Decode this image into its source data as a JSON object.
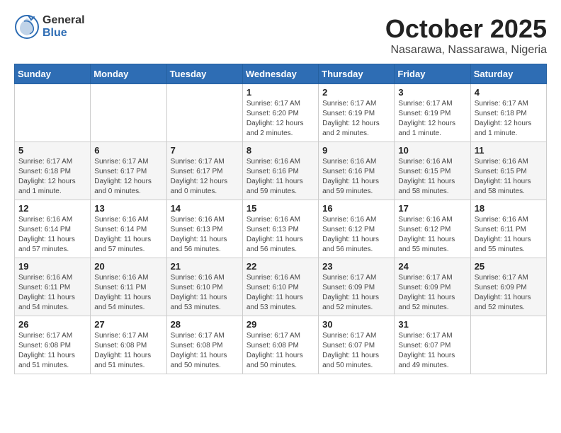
{
  "header": {
    "logo_general": "General",
    "logo_blue": "Blue",
    "month": "October 2025",
    "location": "Nasarawa, Nassarawa, Nigeria"
  },
  "weekdays": [
    "Sunday",
    "Monday",
    "Tuesday",
    "Wednesday",
    "Thursday",
    "Friday",
    "Saturday"
  ],
  "weeks": [
    [
      {
        "day": "",
        "info": ""
      },
      {
        "day": "",
        "info": ""
      },
      {
        "day": "",
        "info": ""
      },
      {
        "day": "1",
        "info": "Sunrise: 6:17 AM\nSunset: 6:20 PM\nDaylight: 12 hours and 2 minutes."
      },
      {
        "day": "2",
        "info": "Sunrise: 6:17 AM\nSunset: 6:19 PM\nDaylight: 12 hours and 2 minutes."
      },
      {
        "day": "3",
        "info": "Sunrise: 6:17 AM\nSunset: 6:19 PM\nDaylight: 12 hours and 1 minute."
      },
      {
        "day": "4",
        "info": "Sunrise: 6:17 AM\nSunset: 6:18 PM\nDaylight: 12 hours and 1 minute."
      }
    ],
    [
      {
        "day": "5",
        "info": "Sunrise: 6:17 AM\nSunset: 6:18 PM\nDaylight: 12 hours and 1 minute."
      },
      {
        "day": "6",
        "info": "Sunrise: 6:17 AM\nSunset: 6:17 PM\nDaylight: 12 hours and 0 minutes."
      },
      {
        "day": "7",
        "info": "Sunrise: 6:17 AM\nSunset: 6:17 PM\nDaylight: 12 hours and 0 minutes."
      },
      {
        "day": "8",
        "info": "Sunrise: 6:16 AM\nSunset: 6:16 PM\nDaylight: 11 hours and 59 minutes."
      },
      {
        "day": "9",
        "info": "Sunrise: 6:16 AM\nSunset: 6:16 PM\nDaylight: 11 hours and 59 minutes."
      },
      {
        "day": "10",
        "info": "Sunrise: 6:16 AM\nSunset: 6:15 PM\nDaylight: 11 hours and 58 minutes."
      },
      {
        "day": "11",
        "info": "Sunrise: 6:16 AM\nSunset: 6:15 PM\nDaylight: 11 hours and 58 minutes."
      }
    ],
    [
      {
        "day": "12",
        "info": "Sunrise: 6:16 AM\nSunset: 6:14 PM\nDaylight: 11 hours and 57 minutes."
      },
      {
        "day": "13",
        "info": "Sunrise: 6:16 AM\nSunset: 6:14 PM\nDaylight: 11 hours and 57 minutes."
      },
      {
        "day": "14",
        "info": "Sunrise: 6:16 AM\nSunset: 6:13 PM\nDaylight: 11 hours and 56 minutes."
      },
      {
        "day": "15",
        "info": "Sunrise: 6:16 AM\nSunset: 6:13 PM\nDaylight: 11 hours and 56 minutes."
      },
      {
        "day": "16",
        "info": "Sunrise: 6:16 AM\nSunset: 6:12 PM\nDaylight: 11 hours and 56 minutes."
      },
      {
        "day": "17",
        "info": "Sunrise: 6:16 AM\nSunset: 6:12 PM\nDaylight: 11 hours and 55 minutes."
      },
      {
        "day": "18",
        "info": "Sunrise: 6:16 AM\nSunset: 6:11 PM\nDaylight: 11 hours and 55 minutes."
      }
    ],
    [
      {
        "day": "19",
        "info": "Sunrise: 6:16 AM\nSunset: 6:11 PM\nDaylight: 11 hours and 54 minutes."
      },
      {
        "day": "20",
        "info": "Sunrise: 6:16 AM\nSunset: 6:11 PM\nDaylight: 11 hours and 54 minutes."
      },
      {
        "day": "21",
        "info": "Sunrise: 6:16 AM\nSunset: 6:10 PM\nDaylight: 11 hours and 53 minutes."
      },
      {
        "day": "22",
        "info": "Sunrise: 6:16 AM\nSunset: 6:10 PM\nDaylight: 11 hours and 53 minutes."
      },
      {
        "day": "23",
        "info": "Sunrise: 6:17 AM\nSunset: 6:09 PM\nDaylight: 11 hours and 52 minutes."
      },
      {
        "day": "24",
        "info": "Sunrise: 6:17 AM\nSunset: 6:09 PM\nDaylight: 11 hours and 52 minutes."
      },
      {
        "day": "25",
        "info": "Sunrise: 6:17 AM\nSunset: 6:09 PM\nDaylight: 11 hours and 52 minutes."
      }
    ],
    [
      {
        "day": "26",
        "info": "Sunrise: 6:17 AM\nSunset: 6:08 PM\nDaylight: 11 hours and 51 minutes."
      },
      {
        "day": "27",
        "info": "Sunrise: 6:17 AM\nSunset: 6:08 PM\nDaylight: 11 hours and 51 minutes."
      },
      {
        "day": "28",
        "info": "Sunrise: 6:17 AM\nSunset: 6:08 PM\nDaylight: 11 hours and 50 minutes."
      },
      {
        "day": "29",
        "info": "Sunrise: 6:17 AM\nSunset: 6:08 PM\nDaylight: 11 hours and 50 minutes."
      },
      {
        "day": "30",
        "info": "Sunrise: 6:17 AM\nSunset: 6:07 PM\nDaylight: 11 hours and 50 minutes."
      },
      {
        "day": "31",
        "info": "Sunrise: 6:17 AM\nSunset: 6:07 PM\nDaylight: 11 hours and 49 minutes."
      },
      {
        "day": "",
        "info": ""
      }
    ]
  ]
}
